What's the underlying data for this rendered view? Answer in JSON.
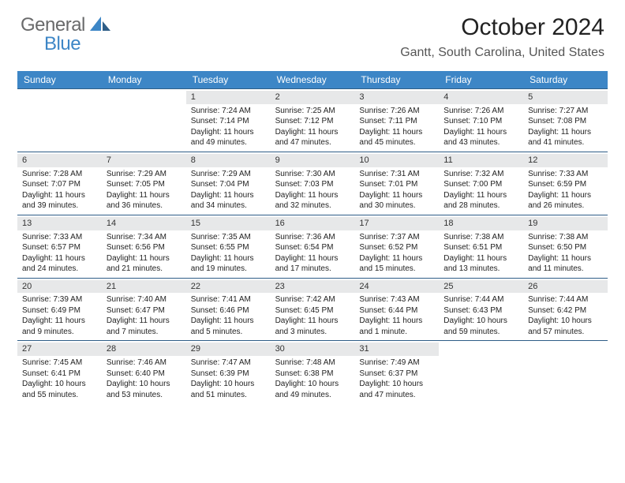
{
  "brand": {
    "part1": "General",
    "part2": "Blue"
  },
  "title": "October 2024",
  "location": "Gantt, South Carolina, United States",
  "dow": [
    "Sunday",
    "Monday",
    "Tuesday",
    "Wednesday",
    "Thursday",
    "Friday",
    "Saturday"
  ],
  "weeks": [
    [
      null,
      null,
      {
        "n": "1",
        "sr": "Sunrise: 7:24 AM",
        "ss": "Sunset: 7:14 PM",
        "d1": "Daylight: 11 hours",
        "d2": "and 49 minutes."
      },
      {
        "n": "2",
        "sr": "Sunrise: 7:25 AM",
        "ss": "Sunset: 7:12 PM",
        "d1": "Daylight: 11 hours",
        "d2": "and 47 minutes."
      },
      {
        "n": "3",
        "sr": "Sunrise: 7:26 AM",
        "ss": "Sunset: 7:11 PM",
        "d1": "Daylight: 11 hours",
        "d2": "and 45 minutes."
      },
      {
        "n": "4",
        "sr": "Sunrise: 7:26 AM",
        "ss": "Sunset: 7:10 PM",
        "d1": "Daylight: 11 hours",
        "d2": "and 43 minutes."
      },
      {
        "n": "5",
        "sr": "Sunrise: 7:27 AM",
        "ss": "Sunset: 7:08 PM",
        "d1": "Daylight: 11 hours",
        "d2": "and 41 minutes."
      }
    ],
    [
      {
        "n": "6",
        "sr": "Sunrise: 7:28 AM",
        "ss": "Sunset: 7:07 PM",
        "d1": "Daylight: 11 hours",
        "d2": "and 39 minutes."
      },
      {
        "n": "7",
        "sr": "Sunrise: 7:29 AM",
        "ss": "Sunset: 7:05 PM",
        "d1": "Daylight: 11 hours",
        "d2": "and 36 minutes."
      },
      {
        "n": "8",
        "sr": "Sunrise: 7:29 AM",
        "ss": "Sunset: 7:04 PM",
        "d1": "Daylight: 11 hours",
        "d2": "and 34 minutes."
      },
      {
        "n": "9",
        "sr": "Sunrise: 7:30 AM",
        "ss": "Sunset: 7:03 PM",
        "d1": "Daylight: 11 hours",
        "d2": "and 32 minutes."
      },
      {
        "n": "10",
        "sr": "Sunrise: 7:31 AM",
        "ss": "Sunset: 7:01 PM",
        "d1": "Daylight: 11 hours",
        "d2": "and 30 minutes."
      },
      {
        "n": "11",
        "sr": "Sunrise: 7:32 AM",
        "ss": "Sunset: 7:00 PM",
        "d1": "Daylight: 11 hours",
        "d2": "and 28 minutes."
      },
      {
        "n": "12",
        "sr": "Sunrise: 7:33 AM",
        "ss": "Sunset: 6:59 PM",
        "d1": "Daylight: 11 hours",
        "d2": "and 26 minutes."
      }
    ],
    [
      {
        "n": "13",
        "sr": "Sunrise: 7:33 AM",
        "ss": "Sunset: 6:57 PM",
        "d1": "Daylight: 11 hours",
        "d2": "and 24 minutes."
      },
      {
        "n": "14",
        "sr": "Sunrise: 7:34 AM",
        "ss": "Sunset: 6:56 PM",
        "d1": "Daylight: 11 hours",
        "d2": "and 21 minutes."
      },
      {
        "n": "15",
        "sr": "Sunrise: 7:35 AM",
        "ss": "Sunset: 6:55 PM",
        "d1": "Daylight: 11 hours",
        "d2": "and 19 minutes."
      },
      {
        "n": "16",
        "sr": "Sunrise: 7:36 AM",
        "ss": "Sunset: 6:54 PM",
        "d1": "Daylight: 11 hours",
        "d2": "and 17 minutes."
      },
      {
        "n": "17",
        "sr": "Sunrise: 7:37 AM",
        "ss": "Sunset: 6:52 PM",
        "d1": "Daylight: 11 hours",
        "d2": "and 15 minutes."
      },
      {
        "n": "18",
        "sr": "Sunrise: 7:38 AM",
        "ss": "Sunset: 6:51 PM",
        "d1": "Daylight: 11 hours",
        "d2": "and 13 minutes."
      },
      {
        "n": "19",
        "sr": "Sunrise: 7:38 AM",
        "ss": "Sunset: 6:50 PM",
        "d1": "Daylight: 11 hours",
        "d2": "and 11 minutes."
      }
    ],
    [
      {
        "n": "20",
        "sr": "Sunrise: 7:39 AM",
        "ss": "Sunset: 6:49 PM",
        "d1": "Daylight: 11 hours",
        "d2": "and 9 minutes."
      },
      {
        "n": "21",
        "sr": "Sunrise: 7:40 AM",
        "ss": "Sunset: 6:47 PM",
        "d1": "Daylight: 11 hours",
        "d2": "and 7 minutes."
      },
      {
        "n": "22",
        "sr": "Sunrise: 7:41 AM",
        "ss": "Sunset: 6:46 PM",
        "d1": "Daylight: 11 hours",
        "d2": "and 5 minutes."
      },
      {
        "n": "23",
        "sr": "Sunrise: 7:42 AM",
        "ss": "Sunset: 6:45 PM",
        "d1": "Daylight: 11 hours",
        "d2": "and 3 minutes."
      },
      {
        "n": "24",
        "sr": "Sunrise: 7:43 AM",
        "ss": "Sunset: 6:44 PM",
        "d1": "Daylight: 11 hours",
        "d2": "and 1 minute."
      },
      {
        "n": "25",
        "sr": "Sunrise: 7:44 AM",
        "ss": "Sunset: 6:43 PM",
        "d1": "Daylight: 10 hours",
        "d2": "and 59 minutes."
      },
      {
        "n": "26",
        "sr": "Sunrise: 7:44 AM",
        "ss": "Sunset: 6:42 PM",
        "d1": "Daylight: 10 hours",
        "d2": "and 57 minutes."
      }
    ],
    [
      {
        "n": "27",
        "sr": "Sunrise: 7:45 AM",
        "ss": "Sunset: 6:41 PM",
        "d1": "Daylight: 10 hours",
        "d2": "and 55 minutes."
      },
      {
        "n": "28",
        "sr": "Sunrise: 7:46 AM",
        "ss": "Sunset: 6:40 PM",
        "d1": "Daylight: 10 hours",
        "d2": "and 53 minutes."
      },
      {
        "n": "29",
        "sr": "Sunrise: 7:47 AM",
        "ss": "Sunset: 6:39 PM",
        "d1": "Daylight: 10 hours",
        "d2": "and 51 minutes."
      },
      {
        "n": "30",
        "sr": "Sunrise: 7:48 AM",
        "ss": "Sunset: 6:38 PM",
        "d1": "Daylight: 10 hours",
        "d2": "and 49 minutes."
      },
      {
        "n": "31",
        "sr": "Sunrise: 7:49 AM",
        "ss": "Sunset: 6:37 PM",
        "d1": "Daylight: 10 hours",
        "d2": "and 47 minutes."
      },
      null,
      null
    ]
  ]
}
